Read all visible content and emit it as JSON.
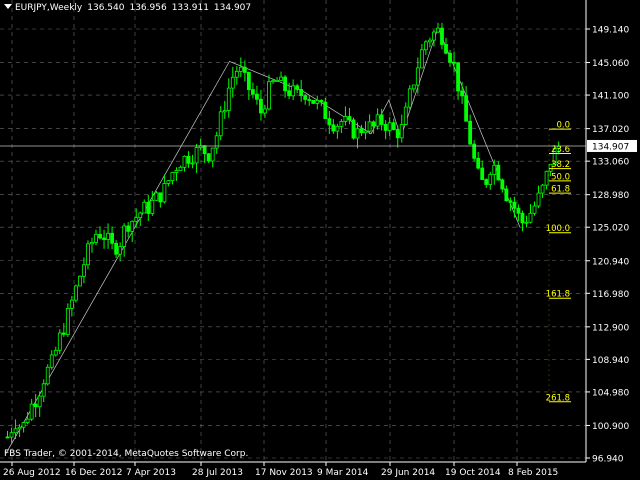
{
  "header": {
    "symbol": "EURJPY,Weekly",
    "open": "136.540",
    "high": "136.956",
    "low": "133.911",
    "close": "134.907"
  },
  "copyright": "FBS Trader, © 2001-2014, MetaQuotes Software Corp.",
  "colors": {
    "background": "#000000",
    "candle": "#00ff00",
    "grid": "#c0c0c0",
    "axis_text": "#ffffff",
    "fibo": "#ffff00",
    "trendline": "#ffffff"
  },
  "chart_data": {
    "type": "candlestick",
    "y_axis": {
      "ticks": [
        "149.140",
        "145.060",
        "141.100",
        "137.020",
        "133.060",
        "128.980",
        "125.020",
        "120.940",
        "116.980",
        "112.900",
        "108.940",
        "104.980",
        "100.900",
        "96.940"
      ],
      "range": [
        96.94,
        151.0
      ]
    },
    "x_axis": {
      "ticks": [
        "26 Aug 2012",
        "16 Dec 2012",
        "7 Apr 2013",
        "28 Jul 2013",
        "17 Nov 2013",
        "9 Mar 2014",
        "29 Jun 2014",
        "19 Oct 2014",
        "8 Feb 2015"
      ]
    },
    "current_price": "134.907",
    "fibonacci_levels": [
      "0.0",
      "23.6",
      "38.2",
      "50.0",
      "61.8",
      "100.0",
      "161.8",
      "261.8"
    ],
    "fibo_prices": [
      136.956,
      133.985,
      132.147,
      130.662,
      129.177,
      124.35,
      116.38,
      103.78
    ],
    "price_path": [
      [
        0,
        99.5
      ],
      [
        5,
        101.5
      ],
      [
        10,
        100.5
      ],
      [
        15,
        103.0
      ],
      [
        20,
        104.5
      ],
      [
        25,
        107.0
      ],
      [
        30,
        108.5
      ],
      [
        35,
        111.5
      ],
      [
        40,
        114.0
      ],
      [
        45,
        117.0
      ],
      [
        50,
        120.0
      ],
      [
        55,
        122.5
      ],
      [
        60,
        124.5
      ],
      [
        65,
        124.0
      ],
      [
        70,
        122.5
      ],
      [
        75,
        123.0
      ],
      [
        80,
        125.5
      ],
      [
        85,
        126.0
      ],
      [
        90,
        127.0
      ],
      [
        95,
        127.5
      ],
      [
        100,
        128.5
      ],
      [
        105,
        129.5
      ],
      [
        110,
        131.5
      ],
      [
        115,
        133.0
      ],
      [
        120,
        133.5
      ],
      [
        125,
        134.0
      ],
      [
        130,
        134.5
      ],
      [
        135,
        134.0
      ],
      [
        140,
        136.0
      ],
      [
        145,
        139.5
      ],
      [
        150,
        143.0
      ],
      [
        155,
        144.5
      ],
      [
        160,
        142.5
      ],
      [
        165,
        141.0
      ],
      [
        170,
        139.0
      ],
      [
        175,
        141.5
      ],
      [
        180,
        143.0
      ],
      [
        185,
        142.0
      ],
      [
        190,
        141.5
      ],
      [
        195,
        141.0
      ],
      [
        200,
        141.5
      ],
      [
        205,
        140.5
      ],
      [
        210,
        139.5
      ],
      [
        215,
        138.5
      ],
      [
        220,
        137.5
      ],
      [
        225,
        138.0
      ],
      [
        230,
        137.0
      ],
      [
        235,
        136.5
      ],
      [
        240,
        137.5
      ],
      [
        245,
        137.0
      ],
      [
        250,
        138.0
      ],
      [
        255,
        137.5
      ],
      [
        260,
        136.5
      ],
      [
        265,
        137.0
      ],
      [
        270,
        141.0
      ],
      [
        275,
        144.5
      ],
      [
        280,
        147.5
      ],
      [
        285,
        148.5
      ],
      [
        290,
        149.0
      ],
      [
        295,
        147.0
      ],
      [
        300,
        144.5
      ],
      [
        305,
        140.0
      ],
      [
        310,
        136.0
      ],
      [
        315,
        131.5
      ],
      [
        320,
        130.0
      ],
      [
        325,
        133.0
      ],
      [
        330,
        131.5
      ],
      [
        335,
        129.0
      ],
      [
        340,
        127.5
      ],
      [
        345,
        125.5
      ],
      [
        350,
        126.5
      ],
      [
        355,
        128.0
      ],
      [
        360,
        130.0
      ],
      [
        365,
        133.5
      ],
      [
        370,
        134.9
      ]
    ]
  }
}
